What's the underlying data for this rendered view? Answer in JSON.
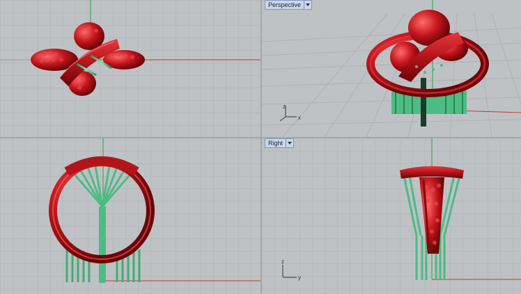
{
  "viewports": {
    "top": {
      "label": ""
    },
    "perspective": {
      "label": "Perspective"
    },
    "front": {
      "label": ""
    },
    "right": {
      "label": "Right"
    }
  },
  "axes": {
    "perspective": {
      "x": "x",
      "z": "z"
    },
    "right": {
      "y": "y",
      "z": "z"
    }
  },
  "colors": {
    "background": "#bfc2c4",
    "grid": "#a9acae",
    "grid_major": "#999c9f",
    "x_axis": "#c0392b",
    "y_axis": "#2e9e48",
    "model_red": "#c4161c",
    "model_supports": "#4dbb84"
  },
  "icons": {
    "dropdown": "chevron-down-icon"
  }
}
